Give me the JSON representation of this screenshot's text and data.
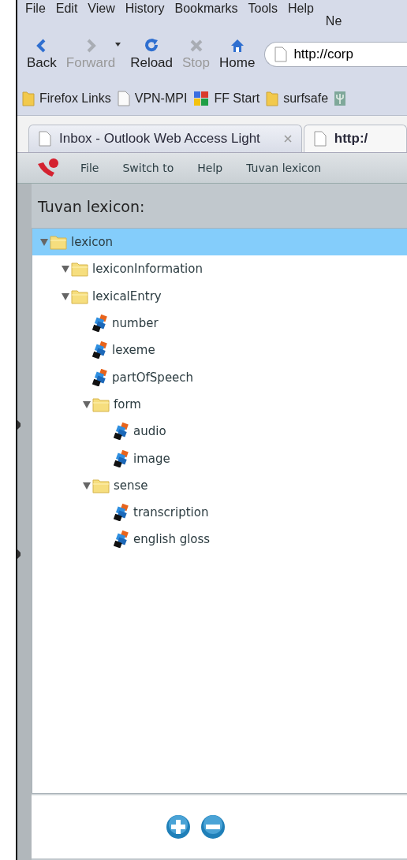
{
  "browser_menu": [
    "File",
    "Edit",
    "View",
    "History",
    "Bookmarks",
    "Tools",
    "Help"
  ],
  "window_title": "Ne",
  "toolbar": [
    {
      "kind": "back",
      "label": "Back",
      "disabled": false
    },
    {
      "kind": "forward",
      "label": "Forward",
      "disabled": true
    },
    {
      "kind": "history"
    },
    {
      "kind": "reload",
      "label": "Reload",
      "disabled": false
    },
    {
      "kind": "stop",
      "label": "Stop",
      "disabled": true
    },
    {
      "kind": "home",
      "label": "Home",
      "disabled": false
    }
  ],
  "address": {
    "value": "http://corp"
  },
  "bookmarks": [
    {
      "kind": "folder",
      "label": "Firefox Links"
    },
    {
      "kind": "page",
      "label": "VPN-MPI"
    },
    {
      "kind": "google",
      "label": "FF Start"
    },
    {
      "kind": "folder",
      "label": "surfsafe"
    },
    {
      "kind": "psi"
    }
  ],
  "tabs": [
    {
      "title": "Inbox - Outlook Web Access Light",
      "selected": false,
      "closable": true
    },
    {
      "title": "http:/",
      "selected": true,
      "closable": false
    }
  ],
  "app_menu": [
    "File",
    "Switch to",
    "Help",
    "Tuvan lexicon"
  ],
  "panel_title": "Tuvan lexicon:",
  "tree": [
    {
      "label": "lexicon",
      "kind": "folder",
      "expanded": true,
      "selected": true,
      "children": [
        {
          "label": "lexiconInformation",
          "kind": "folder",
          "expanded": true,
          "selected": false
        },
        {
          "label": "lexicalEntry",
          "kind": "folder",
          "expanded": true,
          "selected": false,
          "children": [
            {
              "label": "number",
              "kind": "field",
              "selected": false
            },
            {
              "label": "lexeme",
              "kind": "field",
              "selected": false
            },
            {
              "label": "partOfSpeech",
              "kind": "field",
              "selected": false
            },
            {
              "label": "form",
              "kind": "folder",
              "expanded": true,
              "selected": false,
              "children": [
                {
                  "label": "audio",
                  "kind": "field",
                  "selected": false
                },
                {
                  "label": "image",
                  "kind": "field",
                  "selected": false
                }
              ]
            },
            {
              "label": "sense",
              "kind": "folder",
              "expanded": true,
              "selected": false,
              "children": [
                {
                  "label": "transcription",
                  "kind": "field",
                  "selected": false
                },
                {
                  "label": "english gloss",
                  "kind": "field",
                  "selected": false
                }
              ]
            }
          ]
        }
      ]
    }
  ],
  "actions": [
    {
      "kind": "add"
    },
    {
      "kind": "remove"
    }
  ]
}
